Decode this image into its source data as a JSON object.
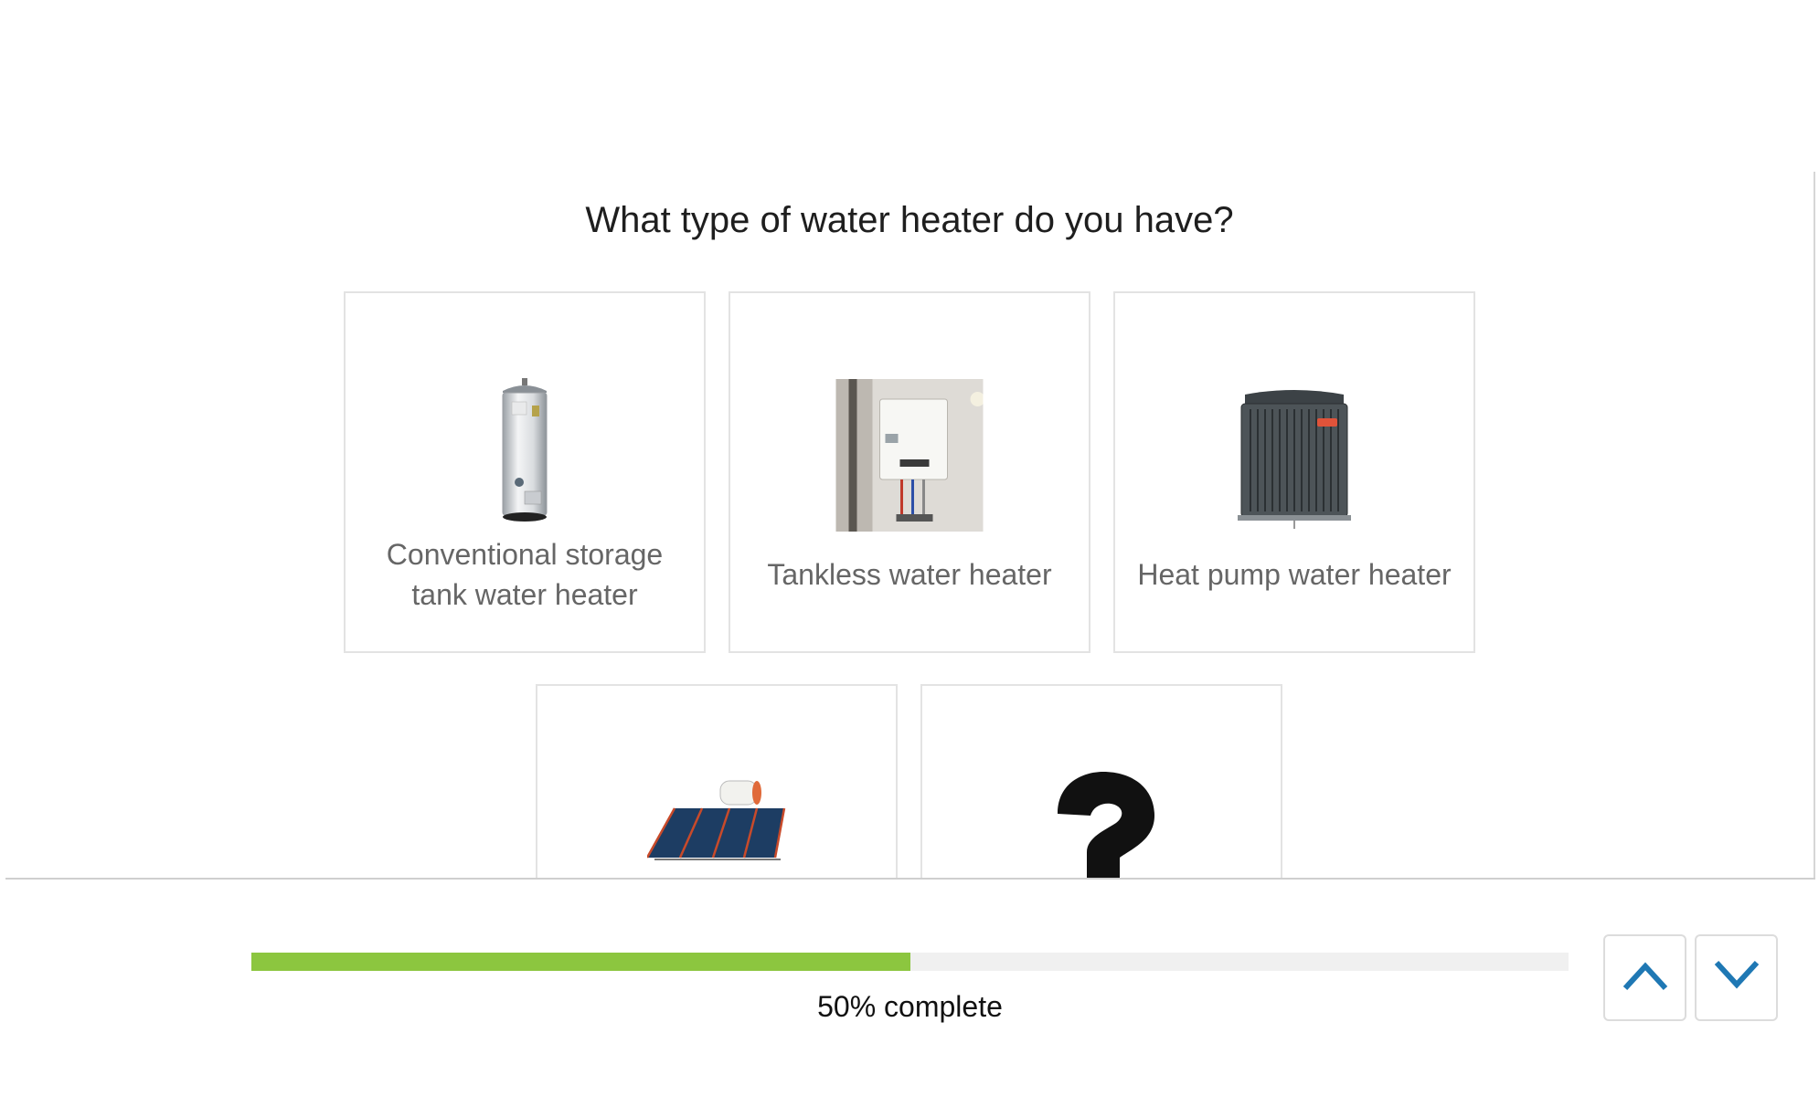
{
  "question": "What type of water heater do you have?",
  "options": [
    {
      "label": "Conventional storage tank water heater",
      "icon": "storage-tank-heater-icon"
    },
    {
      "label": "Tankless water heater",
      "icon": "tankless-heater-icon"
    },
    {
      "label": "Heat pump water heater",
      "icon": "heat-pump-icon"
    },
    {
      "label": "",
      "icon": "solar-water-heater-icon"
    },
    {
      "label": "",
      "icon": "question-mark-icon"
    }
  ],
  "progress": {
    "percent": 50,
    "text": "50% complete"
  },
  "nav": {
    "up_icon": "chevron-up-icon",
    "down_icon": "chevron-down-icon"
  },
  "colors": {
    "progress_fill": "#8cc63f",
    "nav_icon": "#1f78b4",
    "card_border": "#e3e3e3"
  }
}
